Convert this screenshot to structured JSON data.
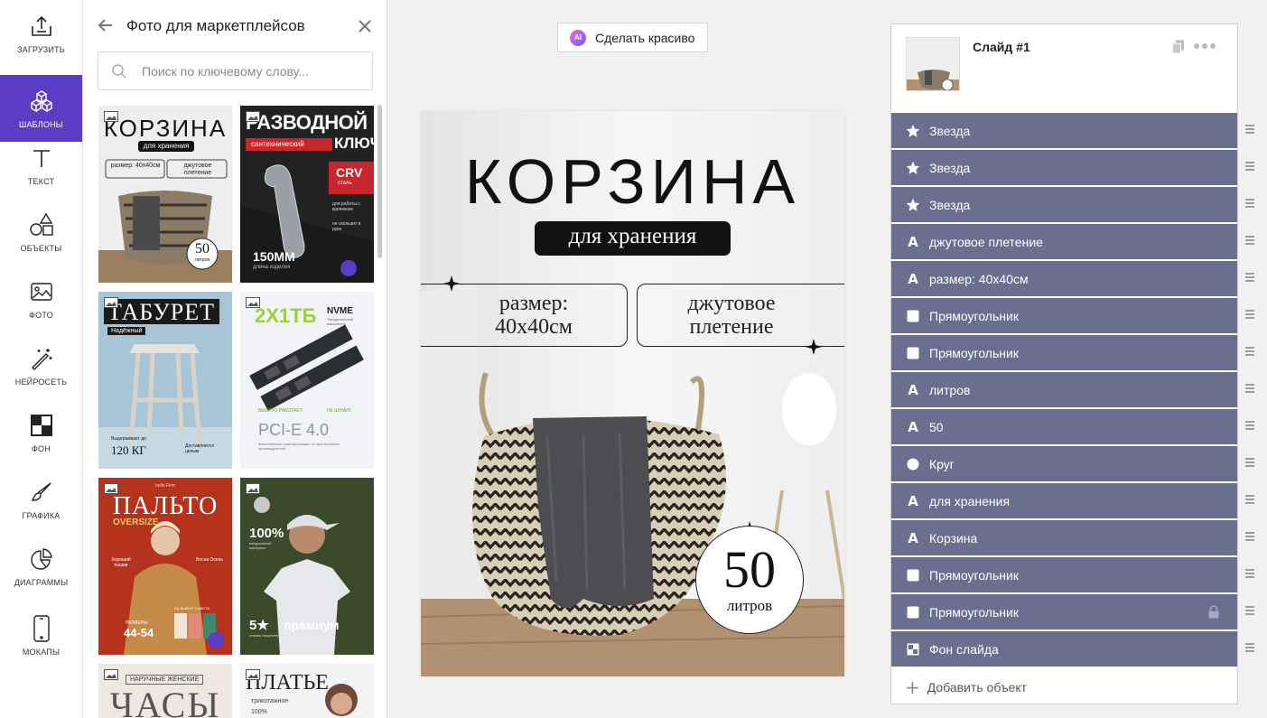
{
  "rail": [
    {
      "label": "ЗАГРУЗИТЬ",
      "icon": "upload-icon"
    },
    {
      "label": "ШАБЛОНЫ",
      "icon": "cubes-icon",
      "active": true
    },
    {
      "label": "ТЕКСТ",
      "icon": "text-icon"
    },
    {
      "label": "ОБЪЕКТЫ",
      "icon": "shapes-icon"
    },
    {
      "label": "ФОТО",
      "icon": "photo-icon"
    },
    {
      "label": "НЕЙРОСЕТЬ",
      "icon": "magic-wand-icon"
    },
    {
      "label": "ФОН",
      "icon": "background-icon"
    },
    {
      "label": "ГРАФИКА",
      "icon": "brush-icon"
    },
    {
      "label": "ДИАГРАММЫ",
      "icon": "pie-chart-icon"
    },
    {
      "label": "МОКАПЫ",
      "icon": "phone-icon"
    }
  ],
  "panel": {
    "title": "Фото для маркетплейсов",
    "search_placeholder": "Поиск по ключевому слову..."
  },
  "templates": {
    "t1": {
      "title": "КОРЗИНА",
      "sub": "для хранения",
      "size": "размер: 40х40см",
      "jute": "джутовое плетение",
      "num": "50",
      "unit": "литров"
    },
    "t2": {
      "title1": "РАЗВОДНОЙ",
      "title2": "КЛЮЧ",
      "sub": "сантехнический",
      "crv": "CRV",
      "steel": "сталь",
      "f1": "для работы с крепежом",
      "f2": "не скользит в руке",
      "size": "150ММ",
      "len": "длина изделия"
    },
    "t3": {
      "title": "ТАБУРЕТ",
      "badge": "Надёжный",
      "cap": "Выдерживает до",
      "weight": "120 КГ",
      "delivery": "Доставляется целым"
    },
    "t4": {
      "title": "2X1TБ",
      "brand": "NVME",
      "brand_sub": "Твердотельный накопитель",
      "f1": "БЫСТРО РАБОТАЕТ",
      "f2": "НЕ ШУМИТ",
      "iface": "PCI-E 4.0",
      "desc": "Качественные комплектующие от оригинальных производителей"
    },
    "t5": {
      "brand": "hello Firm",
      "title": "ПАЛЬТО",
      "sub": "OVERSIZE",
      "f1": "Хороший пошив",
      "f2": "Весна Осень",
      "sizes_label": "РАЗМЕРЫ",
      "sizes": "44-54",
      "colors": "НА ВЫБОР 3 ЦВЕТА"
    },
    "t6": {
      "pct": "100%",
      "pct_sub": "натуральный материал",
      "stars": "5★",
      "rating_sub": "отзывы покупателей",
      "premium": "премиум"
    },
    "t7": {
      "sub": "НАРУЧНЫЕ ЖЕНСКИЕ",
      "title": "ЧАСЫ"
    },
    "t8": {
      "title": "ПЛАТЬЕ",
      "sub": "трикотажное",
      "extra": "100%"
    }
  },
  "toolbar": {
    "beautify_label": "Сделать красиво",
    "ai_badge": "AI"
  },
  "slide": {
    "title": "КОРЗИНА",
    "subtitle": "для хранения",
    "size_line1": "размер:",
    "size_line2": "40х40см",
    "jute_line1": "джутовое",
    "jute_line2": "плетение",
    "volume_number": "50",
    "volume_unit": "литров"
  },
  "layers": {
    "slide_name": "Слайд #1",
    "items": [
      {
        "label": "Звезда",
        "type": "star"
      },
      {
        "label": "Звезда",
        "type": "star"
      },
      {
        "label": "Звезда",
        "type": "star"
      },
      {
        "label": "джутовое плетение",
        "type": "text"
      },
      {
        "label": "размер: 40х40см",
        "type": "text"
      },
      {
        "label": "Прямоугольник",
        "type": "rect"
      },
      {
        "label": "Прямоугольник",
        "type": "rect"
      },
      {
        "label": "литров",
        "type": "text"
      },
      {
        "label": "50",
        "type": "text"
      },
      {
        "label": "Круг",
        "type": "circle"
      },
      {
        "label": "для хранения",
        "type": "text"
      },
      {
        "label": "Корзина",
        "type": "text"
      },
      {
        "label": "Прямоугольник",
        "type": "rect"
      },
      {
        "label": "Прямоугольник",
        "type": "rect",
        "locked": true
      },
      {
        "label": "Фон слайда",
        "type": "background"
      }
    ],
    "add_label": "Добавить объект"
  },
  "colors": {
    "accent": "#5b3cc4",
    "layer_bg": "#6b6f8f"
  }
}
